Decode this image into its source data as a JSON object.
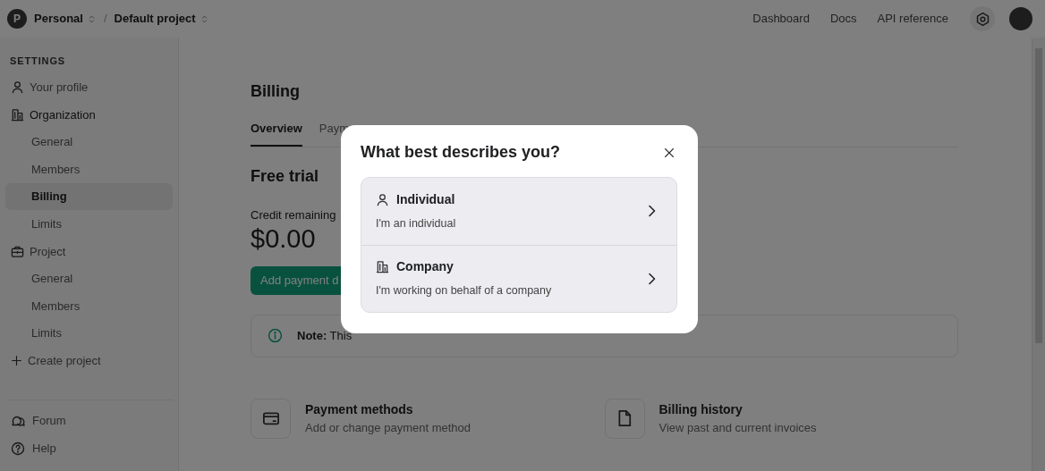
{
  "topbar": {
    "org_initial": "P",
    "breadcrumbs": [
      {
        "label": "Personal"
      },
      {
        "label": "Default project"
      }
    ],
    "separator": "/",
    "links": [
      "Dashboard",
      "Docs",
      "API reference"
    ]
  },
  "sidebar": {
    "heading": "SETTINGS",
    "items": [
      {
        "kind": "profile",
        "label": "Your profile",
        "selected": false
      },
      {
        "kind": "organization",
        "label": "Organization",
        "selected": false
      },
      {
        "kind": "subitem",
        "label": "General",
        "selected": false
      },
      {
        "kind": "subitem",
        "label": "Members",
        "selected": false
      },
      {
        "kind": "subitem",
        "label": "Billing",
        "selected": true
      },
      {
        "kind": "subitem",
        "label": "Limits",
        "selected": false
      },
      {
        "kind": "project",
        "label": "Project",
        "selected": false
      },
      {
        "kind": "subitem",
        "label": "General",
        "selected": false
      },
      {
        "kind": "subitem",
        "label": "Members",
        "selected": false
      },
      {
        "kind": "subitem",
        "label": "Limits",
        "selected": false
      },
      {
        "kind": "create",
        "label": "Create project",
        "selected": false
      }
    ],
    "footer": [
      {
        "kind": "forum",
        "label": "Forum"
      },
      {
        "kind": "help",
        "label": "Help"
      }
    ]
  },
  "main": {
    "title": "Billing",
    "tabs": [
      {
        "label": "Overview",
        "selected": true
      },
      {
        "label": "Paym",
        "selected": false
      }
    ],
    "section_title": "Free trial",
    "credit_label": "Credit remaining",
    "credit_value": "$0.00",
    "button": "Add payment d",
    "note": "**Note:** This",
    "cards": [
      {
        "kind": "card",
        "title": "Payment methods",
        "subtitle": "Add or change payment method"
      },
      {
        "kind": "document",
        "title": "Billing history",
        "subtitle": "View past and current invoices"
      }
    ]
  },
  "modal": {
    "title": "What best describes you?",
    "options": [
      {
        "kind": "individual",
        "title": "Individual",
        "subtitle": "I'm an individual"
      },
      {
        "kind": "company",
        "title": "Company",
        "subtitle": "I'm working on behalf of a company"
      }
    ]
  }
}
